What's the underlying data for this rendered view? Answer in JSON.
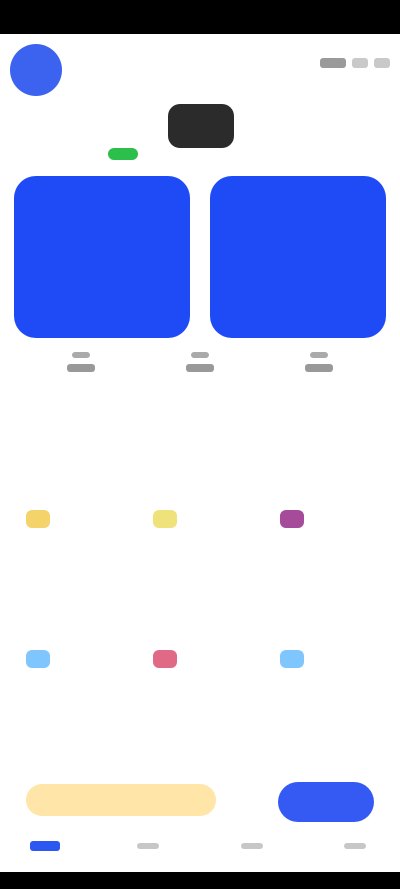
{
  "header": {
    "avatar_text": ""
  },
  "logo_text": "",
  "cards": [
    {
      "value": "",
      "label": "",
      "sub": ""
    },
    {
      "value": "",
      "label": "",
      "sub": ""
    }
  ],
  "stats": [
    {
      "label": ""
    },
    {
      "label": ""
    },
    {
      "label": ""
    }
  ],
  "sections": {
    "section1_title": "",
    "section2_title": ""
  },
  "grid1": [
    {
      "icon": "yellow-icon",
      "title": "",
      "sub": ""
    },
    {
      "icon": "yellow-icon",
      "title": "",
      "sub": ""
    },
    {
      "icon": "purple-icon",
      "title": "",
      "sub": ""
    }
  ],
  "grid2": [
    {
      "icon": "blue-icon",
      "title": "",
      "sub": ""
    },
    {
      "icon": "red-icon",
      "title": "",
      "sub": ""
    },
    {
      "icon": "blue-icon",
      "title": "",
      "sub": ""
    }
  ],
  "banner": {
    "text": "",
    "button_label": ""
  },
  "nav": [
    {
      "label": ""
    },
    {
      "label": ""
    },
    {
      "label": ""
    },
    {
      "label": ""
    }
  ],
  "colors": {
    "primary": "#1f4bf6",
    "accent_green": "#2dbf4b",
    "banner_bg": "#ffe5a8"
  }
}
